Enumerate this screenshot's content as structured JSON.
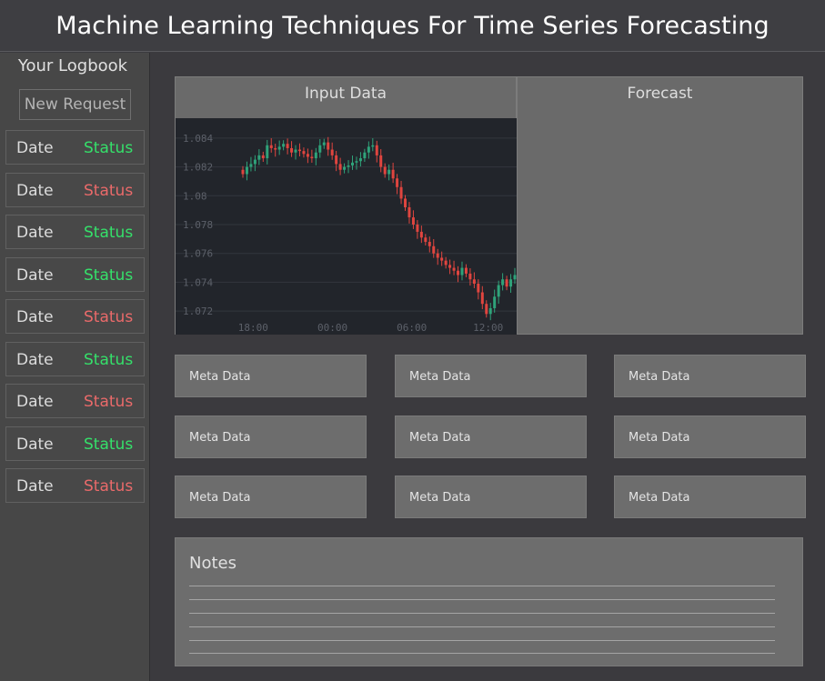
{
  "header": {
    "title": "Machine Learning Techniques For Time Series Forecasting"
  },
  "sidebar": {
    "title": "Your Logbook",
    "new_request_label": "New Request",
    "items": [
      {
        "date": "Date",
        "status": "Status",
        "status_color": "#35e06a"
      },
      {
        "date": "Date",
        "status": "Status",
        "status_color": "#ea6a6a"
      },
      {
        "date": "Date",
        "status": "Status",
        "status_color": "#35e06a"
      },
      {
        "date": "Date",
        "status": "Status",
        "status_color": "#35e06a"
      },
      {
        "date": "Date",
        "status": "Status",
        "status_color": "#ea6a6a"
      },
      {
        "date": "Date",
        "status": "Status",
        "status_color": "#35e06a"
      },
      {
        "date": "Date",
        "status": "Status",
        "status_color": "#ea6a6a"
      },
      {
        "date": "Date",
        "status": "Status",
        "status_color": "#35e06a"
      },
      {
        "date": "Date",
        "status": "Status",
        "status_color": "#ea6a6a"
      }
    ]
  },
  "panels": {
    "input_title": "Input Data",
    "forecast_title": "Forecast"
  },
  "meta": [
    [
      "Meta Data",
      "Meta Data",
      "Meta Data"
    ],
    [
      "Meta Data",
      "Meta Data",
      "Meta Data"
    ],
    [
      "Meta Data",
      "Meta Data",
      "Meta Data"
    ]
  ],
  "notes": {
    "title": "Notes"
  },
  "chart_data": {
    "type": "candlestick",
    "y_ticks": [
      "1.084",
      "1.082",
      "1.08",
      "1.078",
      "1.076",
      "1.074",
      "1.072"
    ],
    "x_ticks": [
      "18:00",
      "00:00",
      "06:00",
      "12:00"
    ],
    "ylim": [
      1.071,
      1.085
    ],
    "colors": {
      "up": "#2fa37a",
      "down": "#e0453f",
      "background": "#22252b",
      "grid": "#33373e",
      "tick": "#5c6069"
    },
    "closes": [
      1.0815,
      1.082,
      1.0822,
      1.0825,
      1.0828,
      1.0826,
      1.0835,
      1.0833,
      1.0832,
      1.0834,
      1.0836,
      1.0833,
      1.083,
      1.0832,
      1.0831,
      1.0829,
      1.0827,
      1.0826,
      1.083,
      1.0835,
      1.0837,
      1.0832,
      1.0828,
      1.0822,
      1.0818,
      1.082,
      1.0821,
      1.0823,
      1.0824,
      1.0826,
      1.083,
      1.0834,
      1.0835,
      1.0828,
      1.082,
      1.0815,
      1.0818,
      1.0812,
      1.0806,
      1.0798,
      1.0792,
      1.0785,
      1.078,
      1.0775,
      1.0771,
      1.0768,
      1.0765,
      1.076,
      1.0757,
      1.0755,
      1.0752,
      1.075,
      1.0748,
      1.0745,
      1.075,
      1.0746,
      1.0742,
      1.0739,
      1.0733,
      1.0725,
      1.0718,
      1.0722,
      1.073,
      1.0738,
      1.0742,
      1.0737,
      1.0742,
      1.0745
    ]
  }
}
